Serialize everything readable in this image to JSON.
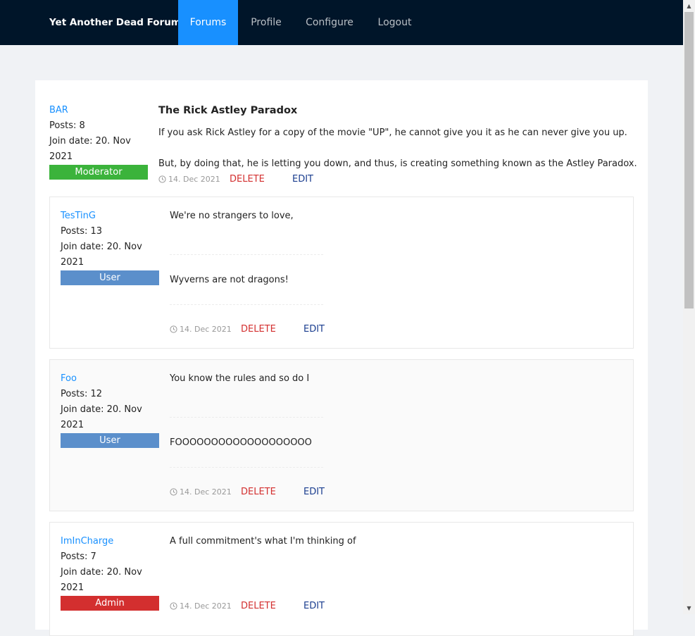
{
  "nav": {
    "brand": "Yet Another Dead Forum",
    "items": [
      "Forums",
      "Profile",
      "Configure",
      "Logout"
    ]
  },
  "topic": {
    "title": "The Rick Astley Paradox",
    "author": {
      "name": "BAR",
      "posts": "Posts: 8",
      "join1": "Join date: 20. Nov",
      "join2": "2021",
      "role": "Moderator",
      "role_color": "#3bb33b"
    },
    "paragraphs": [
      "If you ask Rick Astley for a copy of the movie \"UP\", he cannot give you it as he can never give you up.",
      "But, by doing that, he is letting you down, and thus, is creating something known as the Astley Paradox."
    ],
    "date": "14. Dec 2021",
    "delete": "DELETE",
    "edit": "EDIT"
  },
  "replies": [
    {
      "name": "TesTinG",
      "posts": "Posts: 13",
      "join1": "Join date: 20. Nov",
      "join2": "2021",
      "role": "User",
      "role_color": "#5b8fcb",
      "text": "We're no strangers to love,",
      "signature": "Wyverns are not dragons!",
      "date": "14. Dec 2021",
      "delete": "DELETE",
      "edit": "EDIT"
    },
    {
      "name": "Foo",
      "posts": "Posts: 12",
      "join1": "Join date: 20. Nov",
      "join2": "2021",
      "role": "User",
      "role_color": "#5b8fcb",
      "text": "You know the rules and so do I",
      "signature": "FOOOOOOOOOOOOOOOOOOO",
      "date": "14. Dec 2021",
      "delete": "DELETE",
      "edit": "EDIT"
    },
    {
      "name": "ImInCharge",
      "posts": "Posts: 7",
      "join1": "Join date: 20. Nov",
      "join2": "2021",
      "role": "Admin",
      "role_color": "#d32f2f",
      "text": "A full commitment's what I'm thinking of",
      "date": "14. Dec 2021",
      "delete": "DELETE",
      "edit": "EDIT"
    }
  ]
}
